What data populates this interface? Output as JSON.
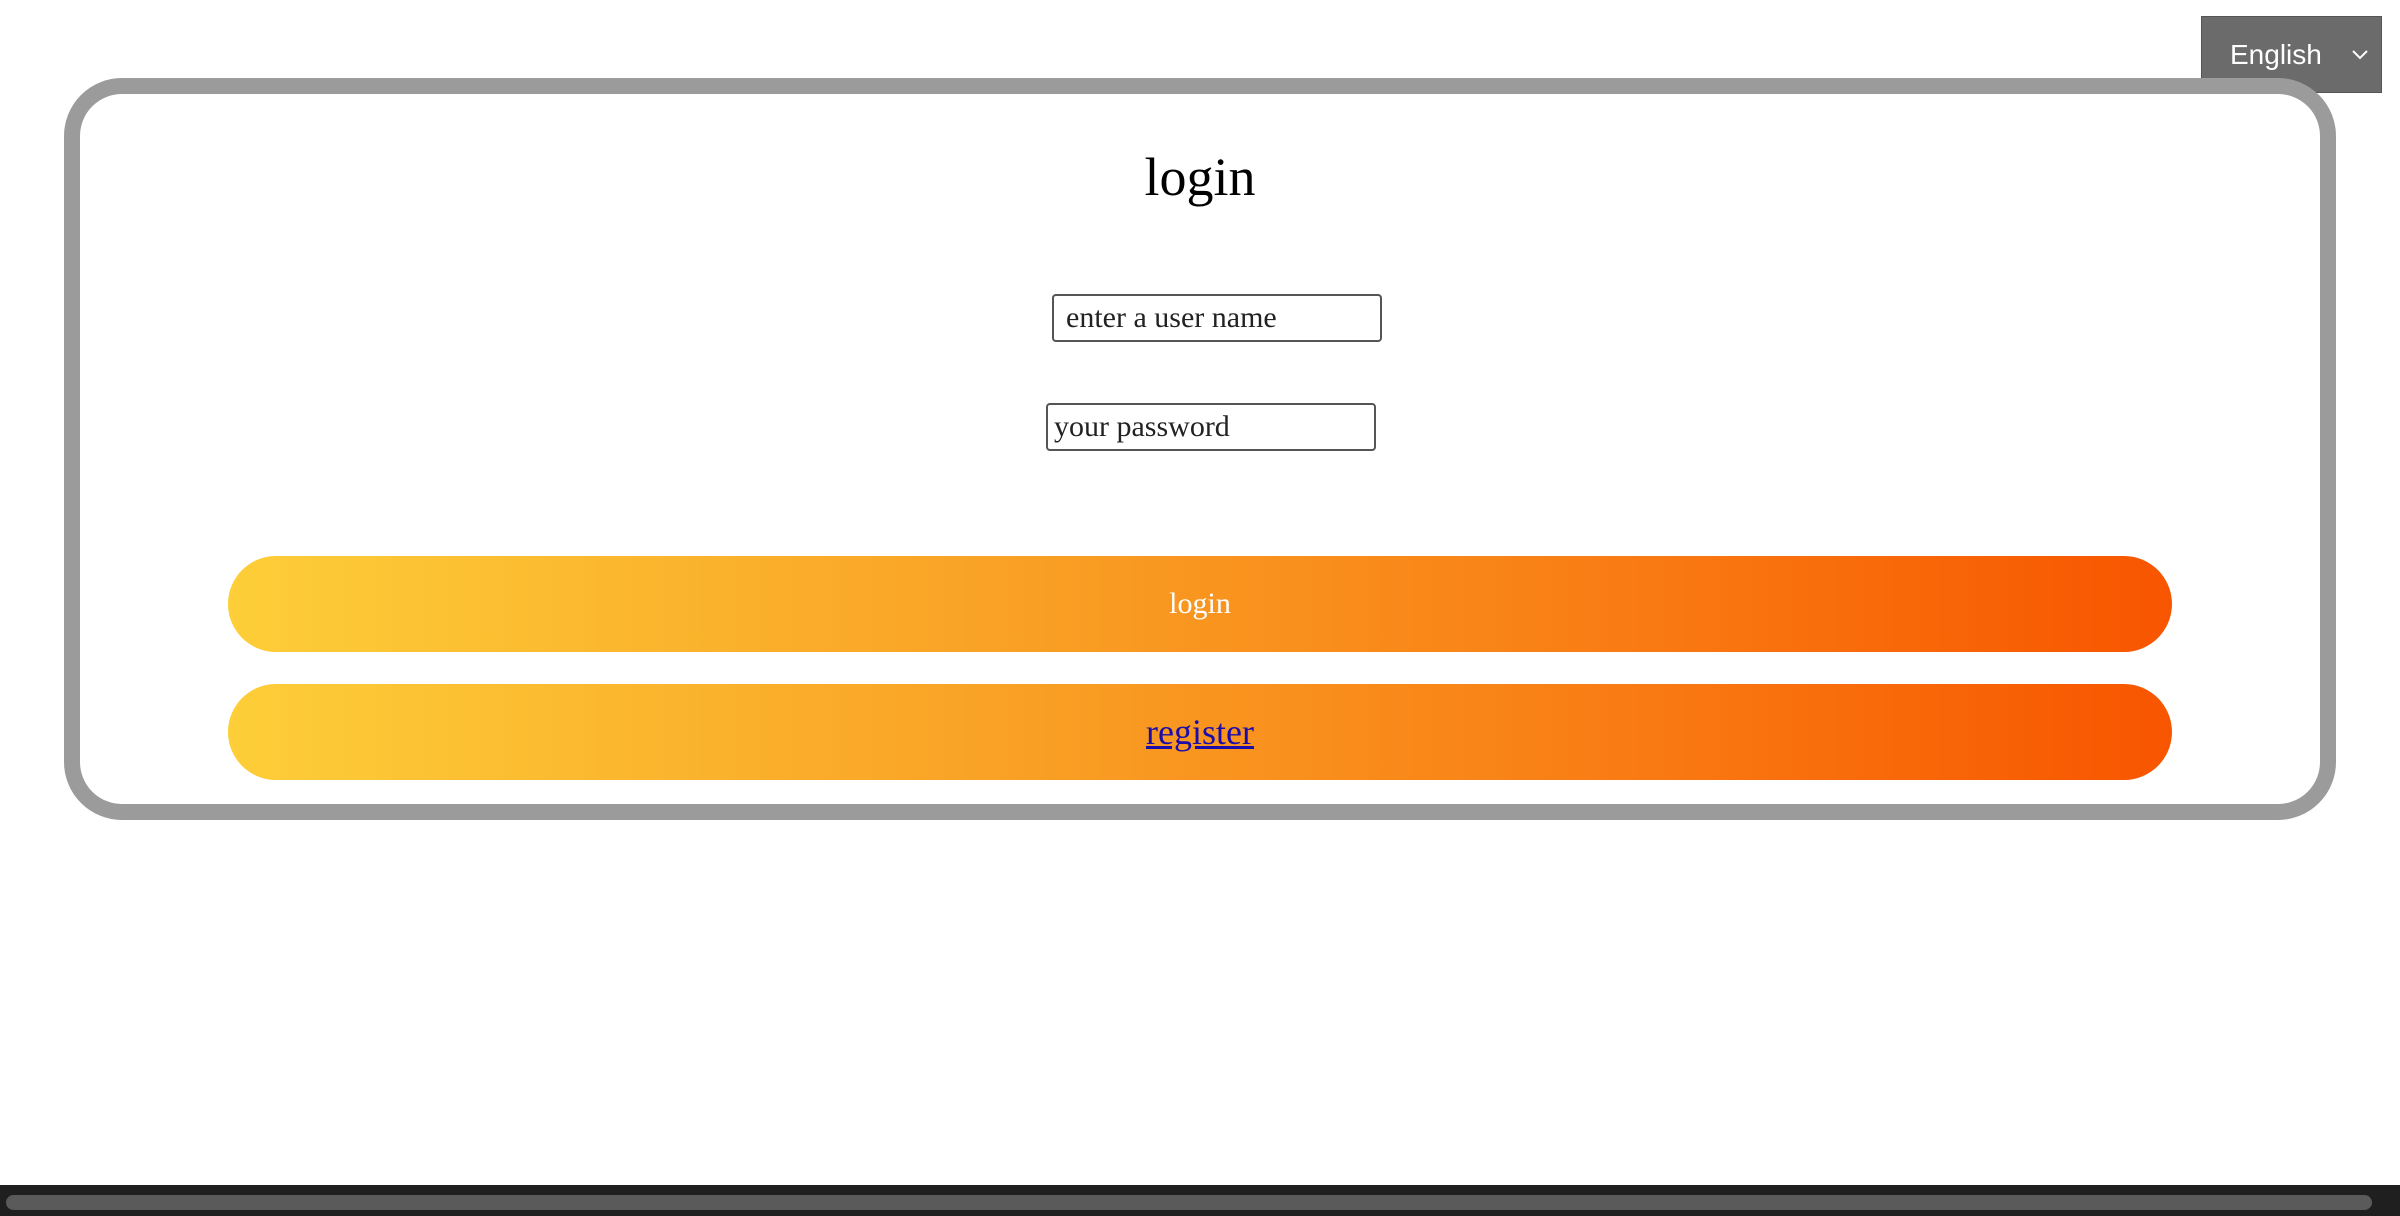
{
  "language_selector": {
    "selected": "English",
    "icon": "chevron-down-icon"
  },
  "login_card": {
    "title": "login",
    "username": {
      "placeholder": "enter a user name",
      "value": ""
    },
    "password": {
      "placeholder": "your password",
      "value": ""
    },
    "login_button_label": "login",
    "register_link_label": "register"
  },
  "colors": {
    "card_border": "#9b9b9b",
    "button_gradient_start": "#fdce38",
    "button_gradient_end": "#f85500",
    "language_selector_bg": "#6b6b6b",
    "link": "#1a0dab"
  }
}
